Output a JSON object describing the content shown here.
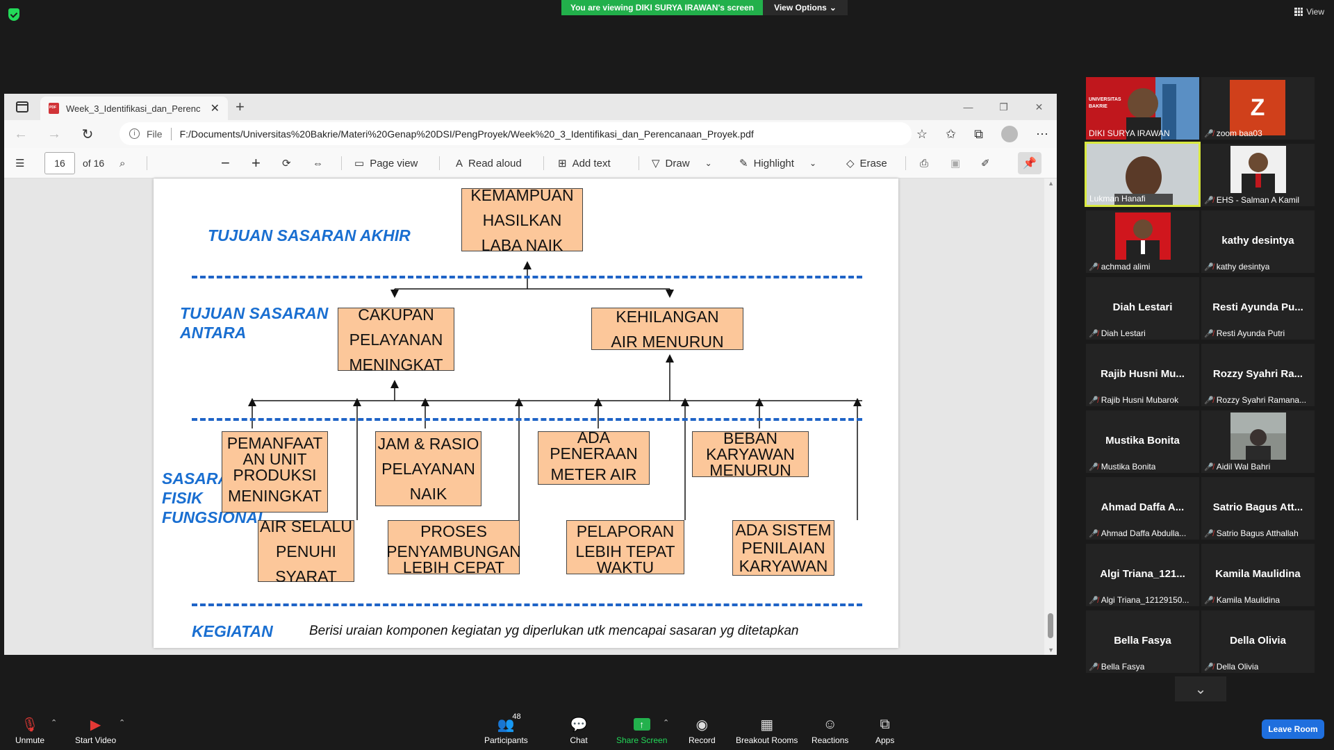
{
  "zoom": {
    "banner": "You are viewing DIKI SURYA IRAWAN's screen",
    "view_options": "View Options",
    "view": "View"
  },
  "browser": {
    "tab_title": "Week_3_Identifikasi_dan_Perenc",
    "url_label": "File",
    "url": "F:/Documents/Universitas%20Bakrie/Materi%20Genap%20DSI/PengProyek/Week%20_3_Identifikasi_dan_Perencanaan_Proyek.pdf"
  },
  "pdf_toolbar": {
    "page_number": "16",
    "page_total": "of 16",
    "page_view": "Page view",
    "read_aloud": "Read aloud",
    "add_text": "Add text",
    "draw": "Draw",
    "highlight": "Highlight",
    "erase": "Erase"
  },
  "diagram": {
    "label_final": "TUJUAN SASARAN AKHIR",
    "label_intermediate": [
      "TUJUAN SASARAN",
      "ANTARA"
    ],
    "label_physical": [
      "SASARAN",
      "FISIK",
      "FUNGSIONAL"
    ],
    "label_activity": "KEGIATAN",
    "activity_note": "Berisi uraian komponen kegiatan yg diperlukan utk mencapai sasaran yg ditetapkan",
    "box_top": [
      "KEMAMPUAN",
      "HASILKAN",
      "LABA NAIK"
    ],
    "box_cakupan": [
      "CAKUPAN",
      "PELAYANAN",
      "MENINGKAT"
    ],
    "box_kehilangan": [
      "KEHILANGAN",
      "AIR MENURUN"
    ],
    "box_pemanfaat": [
      "PEMANFAAT",
      "AN UNIT",
      "PRODUKSI",
      "MENINGKAT"
    ],
    "box_jam": [
      "JAM & RASIO",
      "PELAYANAN",
      "NAIK"
    ],
    "box_ada": [
      "ADA",
      "PENERAAN",
      "METER AIR"
    ],
    "box_beban": [
      "BEBAN",
      "KARYAWAN",
      "MENURUN"
    ],
    "box_air": [
      "AIR SELALU",
      "PENUHI",
      "SYARAT"
    ],
    "box_proses": [
      "PROSES",
      "PENYAMBUNGAN",
      "LEBIH CEPAT"
    ],
    "box_pelaporan": [
      "PELAPORAN",
      "LEBIH TEPAT",
      "WAKTU"
    ],
    "box_sistem": [
      "ADA SISTEM",
      "PENILAIAN",
      "KARYAWAN"
    ]
  },
  "participants": [
    {
      "display": "",
      "label": "DIKI SURYA IRAWAN",
      "muted": false
    },
    {
      "display": "Z",
      "label": "zoom baa03",
      "muted": true
    },
    {
      "display": "",
      "label": "Lukman Hanafi",
      "muted": false
    },
    {
      "display": "",
      "label": "EHS - Salman A Kamil",
      "muted": true
    },
    {
      "display": "",
      "label": "achmad alimi",
      "muted": true
    },
    {
      "display": "kathy desintya",
      "label": "kathy desintya",
      "muted": true
    },
    {
      "display": "Diah Lestari",
      "label": "Diah Lestari",
      "muted": true
    },
    {
      "display": "Resti Ayunda Pu...",
      "label": "Resti Ayunda Putri",
      "muted": true
    },
    {
      "display": "Rajib Husni Mu...",
      "label": "Rajib Husni Mubarok",
      "muted": true
    },
    {
      "display": "Rozzy Syahri Ra...",
      "label": "Rozzy Syahri Ramana...",
      "muted": true
    },
    {
      "display": "Mustika Bonita",
      "label": "Mustika Bonita",
      "muted": true
    },
    {
      "display": "",
      "label": "Aidil Wal Bahri",
      "muted": true
    },
    {
      "display": "Ahmad Daffa A...",
      "label": "Ahmad Daffa Abdulla...",
      "muted": true
    },
    {
      "display": "Satrio Bagus Att...",
      "label": "Satrio Bagus Atthallah",
      "muted": true
    },
    {
      "display": "Algi Triana_121...",
      "label": "Algi Triana_12129150...",
      "muted": true
    },
    {
      "display": "Kamila Maulidina",
      "label": "Kamila Maulidina",
      "muted": true
    },
    {
      "display": "Bella Fasya",
      "label": "Bella Fasya",
      "muted": true
    },
    {
      "display": "Della Olivia",
      "label": "Della Olivia",
      "muted": true
    }
  ],
  "toolbar": {
    "unmute": "Unmute",
    "start_video": "Start Video",
    "participants": "Participants",
    "participants_count": "48",
    "chat": "Chat",
    "share_screen": "Share Screen",
    "record": "Record",
    "breakout": "Breakout Rooms",
    "reactions": "Reactions",
    "apps": "Apps",
    "leave": "Leave Room"
  }
}
